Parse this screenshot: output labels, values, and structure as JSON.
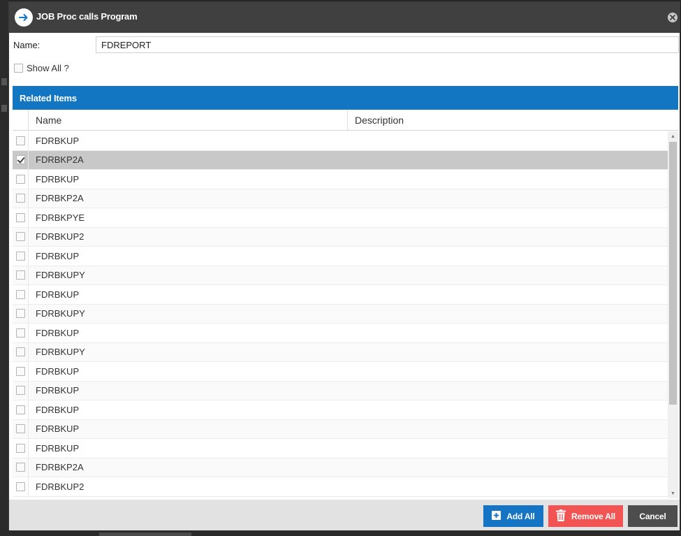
{
  "dialog": {
    "title": "JOB Proc calls Program",
    "title_icon": "arrow-right-circle-icon",
    "close_icon": "close-circle-icon"
  },
  "form": {
    "name_label": "Name:",
    "name_value": "FDREPORT",
    "show_all_label": "Show All ?",
    "show_all_checked": false
  },
  "panel": {
    "header": "Related Items",
    "columns": [
      "Name",
      "Description"
    ],
    "rows": [
      {
        "name": "FDRBKUP",
        "description": "",
        "checked": false
      },
      {
        "name": "FDRBKP2A",
        "description": "",
        "checked": true
      },
      {
        "name": "FDRBKUP",
        "description": "",
        "checked": false
      },
      {
        "name": "FDRBKP2A",
        "description": "",
        "checked": false
      },
      {
        "name": "FDRBKPYE",
        "description": "",
        "checked": false
      },
      {
        "name": "FDRBKUP2",
        "description": "",
        "checked": false
      },
      {
        "name": "FDRBKUP",
        "description": "",
        "checked": false
      },
      {
        "name": "FDRBKUPY",
        "description": "",
        "checked": false
      },
      {
        "name": "FDRBKUP",
        "description": "",
        "checked": false
      },
      {
        "name": "FDRBKUPY",
        "description": "",
        "checked": false
      },
      {
        "name": "FDRBKUP",
        "description": "",
        "checked": false
      },
      {
        "name": "FDRBKUPY",
        "description": "",
        "checked": false
      },
      {
        "name": "FDRBKUP",
        "description": "",
        "checked": false
      },
      {
        "name": "FDRBKUP",
        "description": "",
        "checked": false
      },
      {
        "name": "FDRBKUP",
        "description": "",
        "checked": false
      },
      {
        "name": "FDRBKUP",
        "description": "",
        "checked": false
      },
      {
        "name": "FDRBKUP",
        "description": "",
        "checked": false
      },
      {
        "name": "FDRBKP2A",
        "description": "",
        "checked": false
      },
      {
        "name": "FDRBKUP2",
        "description": "",
        "checked": false
      }
    ]
  },
  "footer": {
    "add_all_label": "Add All",
    "add_all_icon": "plus-square-icon",
    "remove_all_label": "Remove All",
    "remove_all_icon": "trash-icon",
    "cancel_label": "Cancel"
  },
  "colors": {
    "titlebar": "#404040",
    "panel_header": "#1276c2",
    "add_button": "#1674c4",
    "remove_button": "#f25454",
    "cancel_button": "#4d4d4d",
    "selected_row": "#c8c8c8"
  }
}
